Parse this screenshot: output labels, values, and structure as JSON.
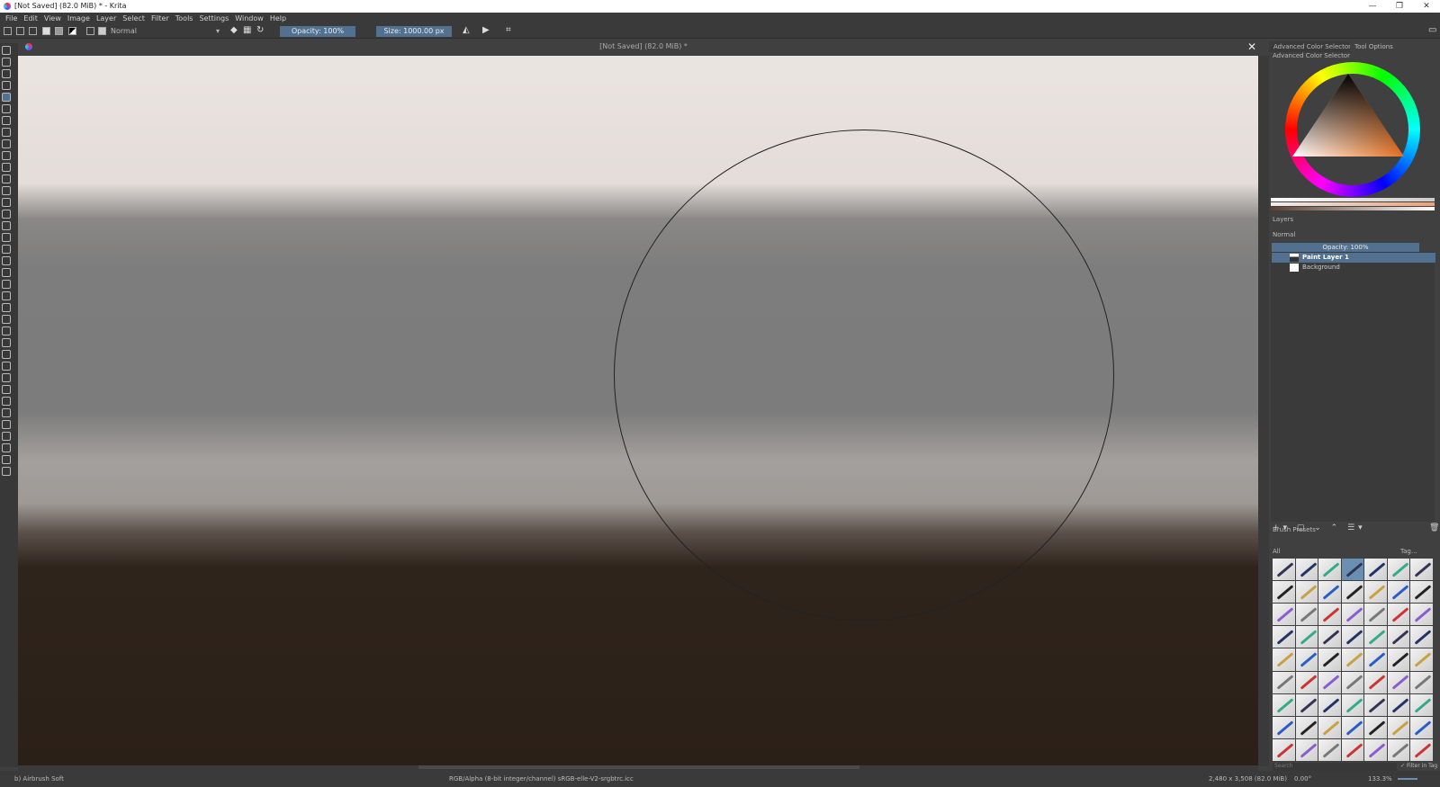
{
  "window": {
    "title": "[Not Saved]  (82.0 MiB) * - Krita"
  },
  "menu": [
    "File",
    "Edit",
    "View",
    "Image",
    "Layer",
    "Select",
    "Filter",
    "Tools",
    "Settings",
    "Window",
    "Help"
  ],
  "toolbar": {
    "blend_mode": "Normal",
    "opacity": "Opacity: 100%",
    "size": "Size: 1000.00 px"
  },
  "document": {
    "tab_title": "[Not Saved]  (82.0 MiB) *",
    "close": "✕"
  },
  "dock": {
    "tabs": [
      "Advanced Color Selector",
      "Tool Options"
    ],
    "color_selector_title": "Advanced Color Selector",
    "layers_title": "Layers",
    "layers_blend": "Normal",
    "layers_opacity": "Opacity:  100%",
    "layers": [
      {
        "name": "Paint Layer 1",
        "selected": true
      },
      {
        "name": "Background",
        "selected": false
      }
    ],
    "brush_presets_title": "Brush Presets",
    "brush_filter": "All",
    "brush_tag": "Tag...",
    "search_placeholder": "Search",
    "filter_in_tag": "Filter in Tag"
  },
  "status": {
    "brush": "b) Airbrush Soft",
    "color_space": "RGB/Alpha (8-bit integer/channel)  sRGB-elle-V2-srgbtrc.icc",
    "dimensions": "2,480 x 3,508 (82.0 MiB)",
    "rotation": "0.00°",
    "zoom": "133.3%"
  },
  "colors": {
    "accent": "#52708f",
    "fg": "#2b2018"
  }
}
